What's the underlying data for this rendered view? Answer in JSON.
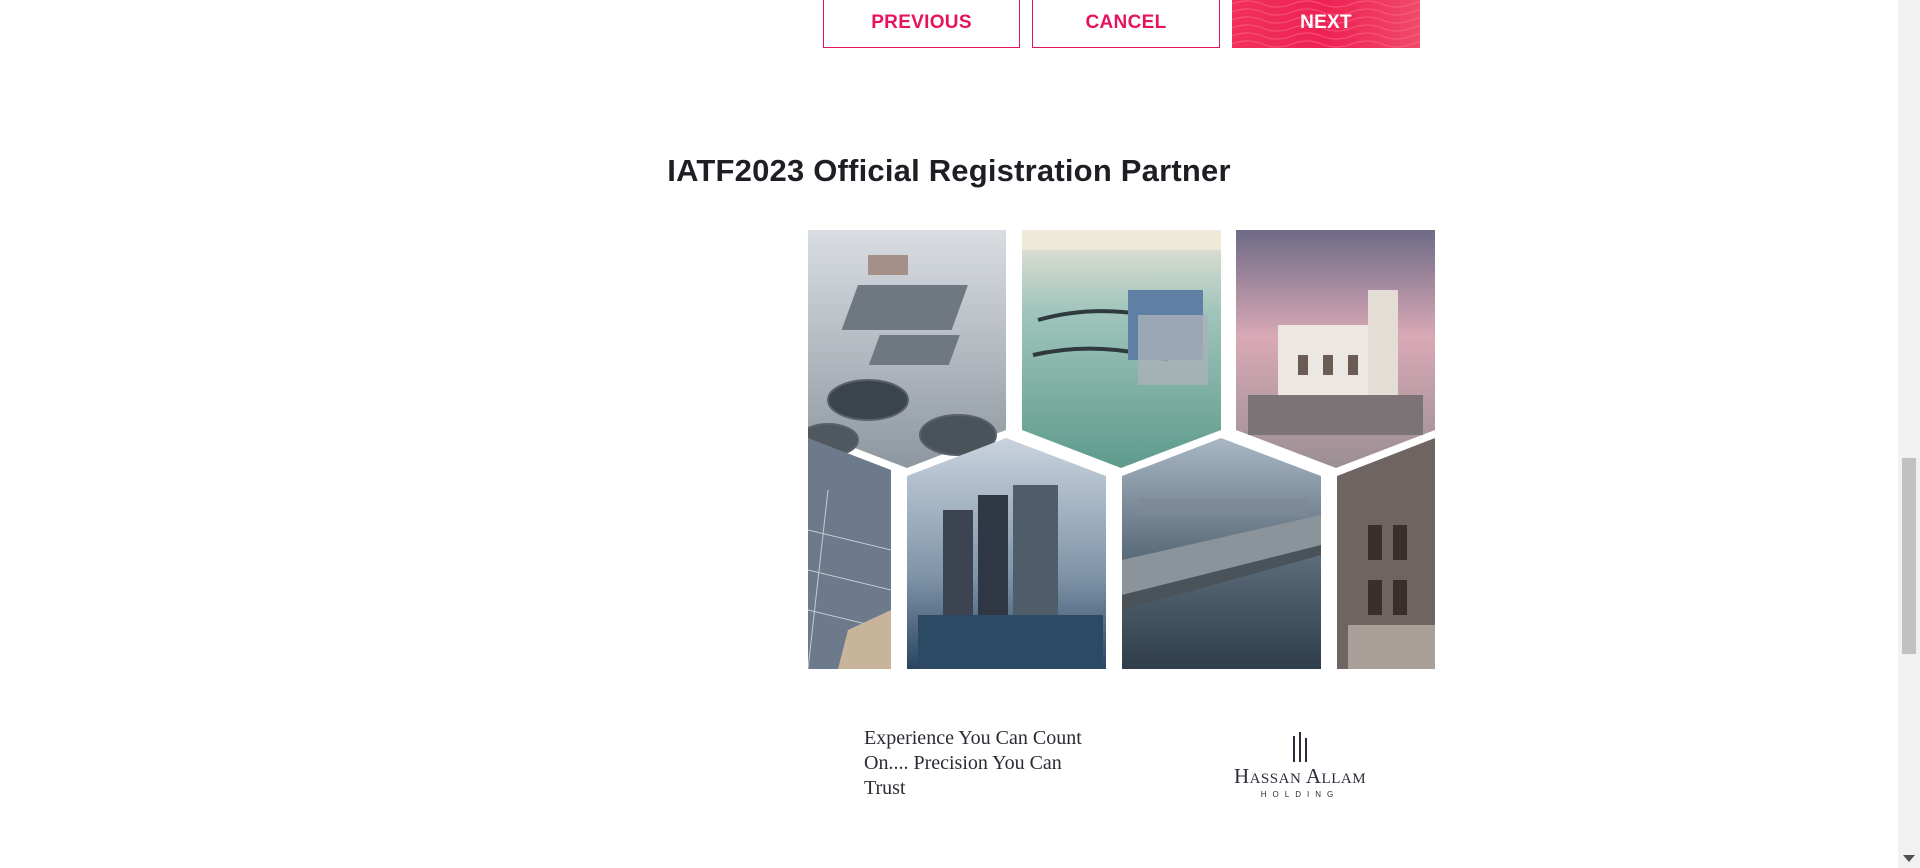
{
  "buttons": {
    "previous": "PREVIOUS",
    "cancel": "CANCEL",
    "next": "NEXT"
  },
  "section": {
    "title": "IATF2023 Official Registration Partner"
  },
  "ad": {
    "tagline": "Experience You Can Count On.... Precision You Can Trust",
    "logo_name": "Hassan Allam",
    "logo_sub": "HOLDING"
  },
  "colors": {
    "accent": "#e6145f",
    "title": "#1d1f24"
  }
}
